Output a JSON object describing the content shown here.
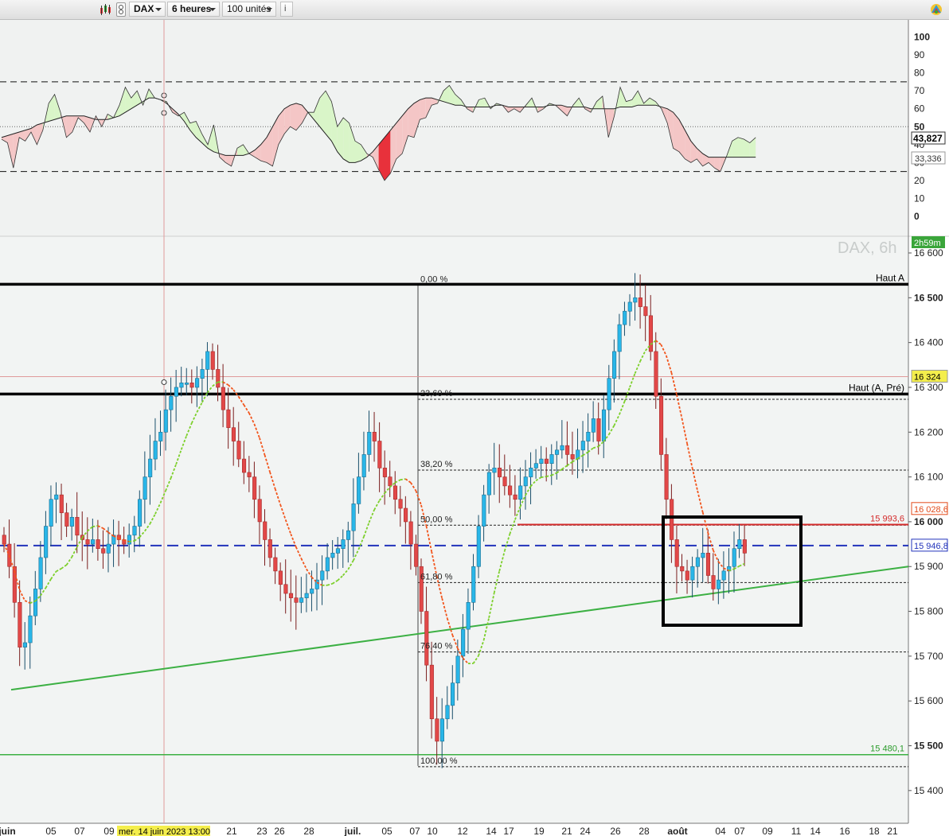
{
  "toolbar": {
    "chart_icon": "candlestick-chart-icon",
    "settings_icon": "bars-settings-icon",
    "symbol": "DAX",
    "timeframe": "6 heures",
    "units": "100 unités",
    "info_icon": "info-icon",
    "logo_icon": "colorful-logo-icon"
  },
  "chart_data": [
    {
      "type": "line",
      "panel": "oscillator",
      "ylim": [
        0,
        100
      ],
      "yticks": [
        "100",
        "90",
        "80",
        "70",
        "60",
        "50",
        "40",
        "30",
        "20",
        "10",
        "0"
      ],
      "reference_lines": [
        75,
        25
      ],
      "midline": 50,
      "last_values": {
        "oscillator": "43,827",
        "signal": "33,336"
      },
      "colors": {
        "above": "#d9f5c8",
        "below": "#f4c6c6",
        "extreme_low": "#e8313b"
      },
      "series": [
        {
          "values": [
            43,
            41,
            27,
            44,
            42,
            47,
            40,
            48,
            63,
            68,
            58,
            44,
            47,
            55,
            52,
            47,
            56,
            50,
            57,
            55,
            62,
            72,
            66,
            70,
            62,
            71,
            66,
            65,
            64,
            58,
            56,
            58,
            52,
            53,
            46,
            40,
            51,
            33,
            30,
            28,
            38,
            40,
            35,
            33,
            31,
            30,
            28,
            40,
            46,
            50,
            48,
            52,
            58,
            58,
            66,
            70,
            64,
            50,
            55,
            52,
            42,
            40,
            35,
            33,
            26,
            20,
            24,
            32,
            35,
            45,
            44,
            54,
            55,
            62,
            63,
            70,
            73,
            68,
            65,
            60,
            58,
            65,
            66,
            60,
            63,
            62,
            58,
            60,
            58,
            62,
            66,
            58,
            60,
            63,
            62,
            59,
            56,
            62,
            66,
            60,
            58,
            64,
            67,
            44,
            56,
            72,
            64,
            65,
            70,
            63,
            66,
            64,
            60,
            52,
            38,
            36,
            32,
            30,
            32,
            28,
            30,
            27,
            25,
            33,
            42,
            44,
            43,
            41,
            44
          ]
        },
        {
          "values": [
            44,
            45,
            46,
            47,
            48,
            49,
            51,
            52,
            53,
            54,
            55,
            56,
            56,
            56,
            56,
            55,
            54,
            54,
            54,
            55,
            56,
            58,
            60,
            62,
            64,
            66,
            66,
            65,
            63,
            60,
            57,
            53,
            48,
            44,
            41,
            38,
            36,
            35,
            34,
            34,
            34,
            34,
            35,
            37,
            40,
            44,
            50,
            56,
            60,
            62,
            63,
            62,
            58,
            54,
            50,
            46,
            42,
            36,
            32,
            30,
            30,
            31,
            33,
            36,
            40,
            44,
            48,
            52,
            56,
            60,
            63,
            65,
            66,
            66,
            65,
            64,
            63,
            62,
            62,
            61,
            61,
            61,
            61,
            61,
            62,
            62,
            61,
            61,
            61,
            61,
            61,
            61,
            61,
            62,
            62,
            62,
            61,
            61,
            61,
            61,
            60,
            60,
            60,
            60,
            60,
            61,
            61,
            61,
            62,
            62,
            62,
            62,
            61,
            60,
            58,
            54,
            48,
            42,
            38,
            35,
            33,
            33,
            33,
            33,
            33,
            33,
            33,
            33,
            33
          ]
        }
      ]
    },
    {
      "type": "candlestick",
      "panel": "price",
      "watermark": "DAX, 6h",
      "timer": "2h59m",
      "ylim": [
        15330,
        16630
      ],
      "yticks": [
        "16 600",
        "16 500",
        "16 400",
        "16 300",
        "16 200",
        "16 100",
        "16 000",
        "15 900",
        "15 800",
        "15 700",
        "15 600",
        "15 500",
        "15 400"
      ],
      "x_labels": [
        "juin",
        "05",
        "07",
        "09",
        "14",
        "21",
        "23",
        "26",
        "28",
        "juil.",
        "05",
        "07",
        "10",
        "12",
        "14",
        "17",
        "19",
        "21",
        "24",
        "26",
        "28",
        "août",
        "04",
        "07",
        "09",
        "11",
        "14",
        "16",
        "18",
        "21"
      ],
      "crosshair_date": "mer. 14 juin 2023 13:00",
      "price_tags": {
        "crosshair": "16 324",
        "resistance": "15 993,6",
        "ma": "16 028,6",
        "dashed_level": "15 946,8",
        "support": "15 480,1"
      },
      "horizontal_lines": [
        {
          "label": "Haut A",
          "value": 16530
        },
        {
          "label": "Haut (A, Pré)",
          "value": 16285
        },
        {
          "label": "15 993,6",
          "value": 15993.6
        },
        {
          "label": "15 946,8",
          "value": 15946.8
        },
        {
          "label": "15 480,1",
          "value": 15480.1
        }
      ],
      "fibonacci": {
        "high": 16530,
        "low": 15480,
        "levels": [
          {
            "label": "0,00 %",
            "value": 16530
          },
          {
            "label": "23,60 %",
            "value": 16275
          },
          {
            "label": "38,20 %",
            "value": 16117
          },
          {
            "label": "50,00 %",
            "value": 15994
          },
          {
            "label": "61,80 %",
            "value": 15866
          },
          {
            "label": "76,40 %",
            "value": 15711
          },
          {
            "label": "100,00 %",
            "value": 15455
          }
        ]
      },
      "trendline": {
        "from": 15625,
        "to": 15900
      },
      "closes": [
        15950,
        15900,
        15820,
        15720,
        15730,
        15790,
        15850,
        15920,
        15990,
        16050,
        16060,
        16020,
        15990,
        16010,
        15970,
        15960,
        15950,
        15960,
        15940,
        15930,
        15950,
        15970,
        15960,
        15950,
        15970,
        15990,
        16050,
        16100,
        16140,
        16180,
        16200,
        16250,
        16280,
        16300,
        16310,
        16310,
        16300,
        16320,
        16340,
        16380,
        16340,
        16300,
        16250,
        16210,
        16180,
        16140,
        16110,
        16100,
        16050,
        16000,
        15960,
        15920,
        15890,
        15860,
        15840,
        15830,
        15820,
        15830,
        15840,
        15850,
        15870,
        15890,
        15920,
        15930,
        15940,
        15960,
        15980,
        16040,
        16100,
        16150,
        16200,
        16180,
        16120,
        16100,
        16080,
        16050,
        16030,
        16000,
        15950,
        15900,
        15800,
        15680,
        15560,
        15510,
        15560,
        15590,
        15640,
        15700,
        15760,
        15820,
        15900,
        15990,
        16060,
        16110,
        16120,
        16100,
        16080,
        16060,
        16050,
        16080,
        16100,
        16120,
        16130,
        16140,
        16130,
        16150,
        16160,
        16170,
        16150,
        16140,
        16160,
        16180,
        16200,
        16230,
        16180,
        16250,
        16320,
        16380,
        16440,
        16470,
        16490,
        16500,
        16480,
        16460,
        16380,
        16280,
        16150,
        16050,
        15960,
        15900,
        15890,
        15870,
        15900,
        15920,
        15930,
        15880,
        15850,
        15870,
        15890,
        15900,
        15940,
        15960,
        15930
      ]
    }
  ]
}
